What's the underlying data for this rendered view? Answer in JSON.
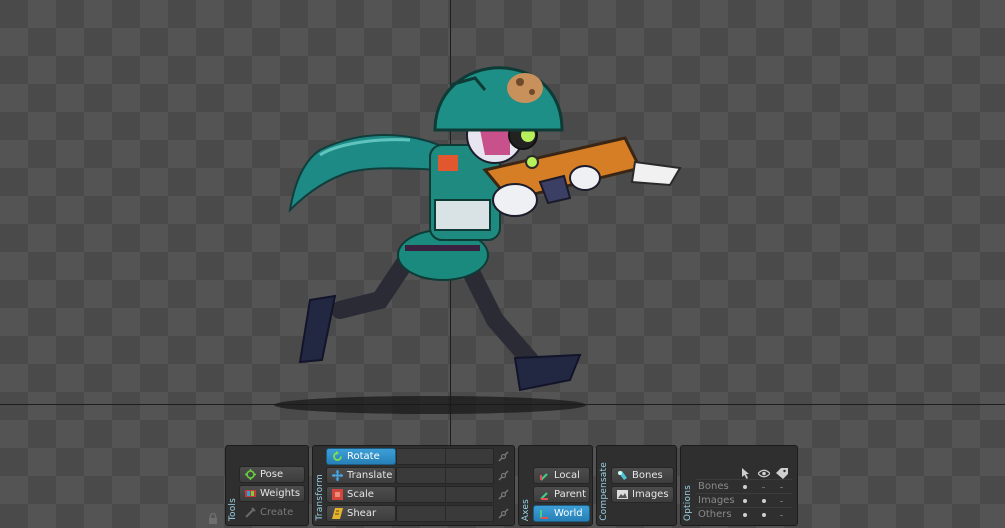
{
  "viewport": {
    "background": "checkerboard",
    "axis_color": "#1e1e1e"
  },
  "tools": {
    "title": "Tools",
    "buttons": [
      {
        "label": "Pose",
        "icon": "pose-icon",
        "active": false
      },
      {
        "label": "Weights",
        "icon": "weights-icon",
        "active": false
      },
      {
        "label": "Create",
        "icon": "create-icon",
        "active": false,
        "disabled": true
      }
    ]
  },
  "transform": {
    "title": "Transform",
    "buttons": [
      {
        "label": "Rotate",
        "icon": "rotate-icon",
        "active": true
      },
      {
        "label": "Translate",
        "icon": "translate-icon",
        "active": false
      },
      {
        "label": "Scale",
        "icon": "scale-icon",
        "active": false
      },
      {
        "label": "Shear",
        "icon": "shear-icon",
        "active": false
      }
    ]
  },
  "axes": {
    "title": "Axes",
    "buttons": [
      {
        "label": "Local",
        "icon": "local-axis-icon",
        "active": false
      },
      {
        "label": "Parent",
        "icon": "parent-axis-icon",
        "active": false
      },
      {
        "label": "World",
        "icon": "world-axis-icon",
        "active": true
      }
    ]
  },
  "compensate": {
    "title": "Compensate",
    "buttons": [
      {
        "label": "Bones",
        "icon": "bones-icon",
        "active": false
      },
      {
        "label": "Images",
        "icon": "images-icon",
        "active": false
      }
    ]
  },
  "options": {
    "title": "Options",
    "columns": [
      "select-icon",
      "visibility-icon",
      "names-icon"
    ],
    "rows": [
      {
        "label": "Bones",
        "values": [
          true,
          false,
          false
        ]
      },
      {
        "label": "Images",
        "values": [
          true,
          true,
          false
        ]
      },
      {
        "label": "Others",
        "values": [
          true,
          true,
          false
        ]
      }
    ]
  },
  "colors": {
    "accent": "#2f8fd0",
    "panel": "#2f2f2f",
    "title": "#9ad0e6"
  }
}
